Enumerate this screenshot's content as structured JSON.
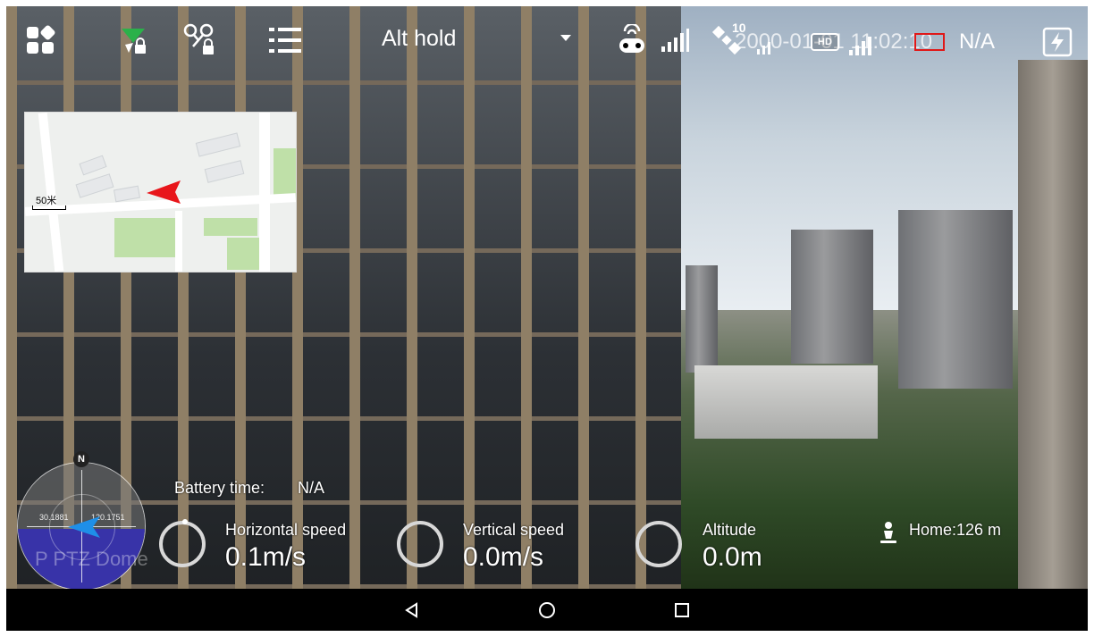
{
  "top_bar": {
    "flight_mode": "Alt hold",
    "satellite_count": "10",
    "status_overlay": "2000-01-01 11:02:10",
    "na_value": "N/A",
    "hd_badge": "HD"
  },
  "map": {
    "scale_label": "50米"
  },
  "compass": {
    "north_label": "N",
    "coord_left": "30.1881",
    "coord_right": "120.1751",
    "camera_label": "P PTZ Dome"
  },
  "telemetry": {
    "battery_label": "Battery time:",
    "battery_value": "N/A",
    "horizontal_speed_label": "Horizontal speed",
    "horizontal_speed_value": "0.1m/s",
    "vertical_speed_label": "Vertical speed",
    "vertical_speed_value": "0.0m/s",
    "altitude_label": "Altitude",
    "altitude_value": "0.0m",
    "home_label": "Home:126 m"
  },
  "colors": {
    "map_arrow": "#e8161b",
    "compass_arrow": "#1e8fe8",
    "recording_box": "#e01818",
    "horizon_lower": "#3833a8"
  }
}
